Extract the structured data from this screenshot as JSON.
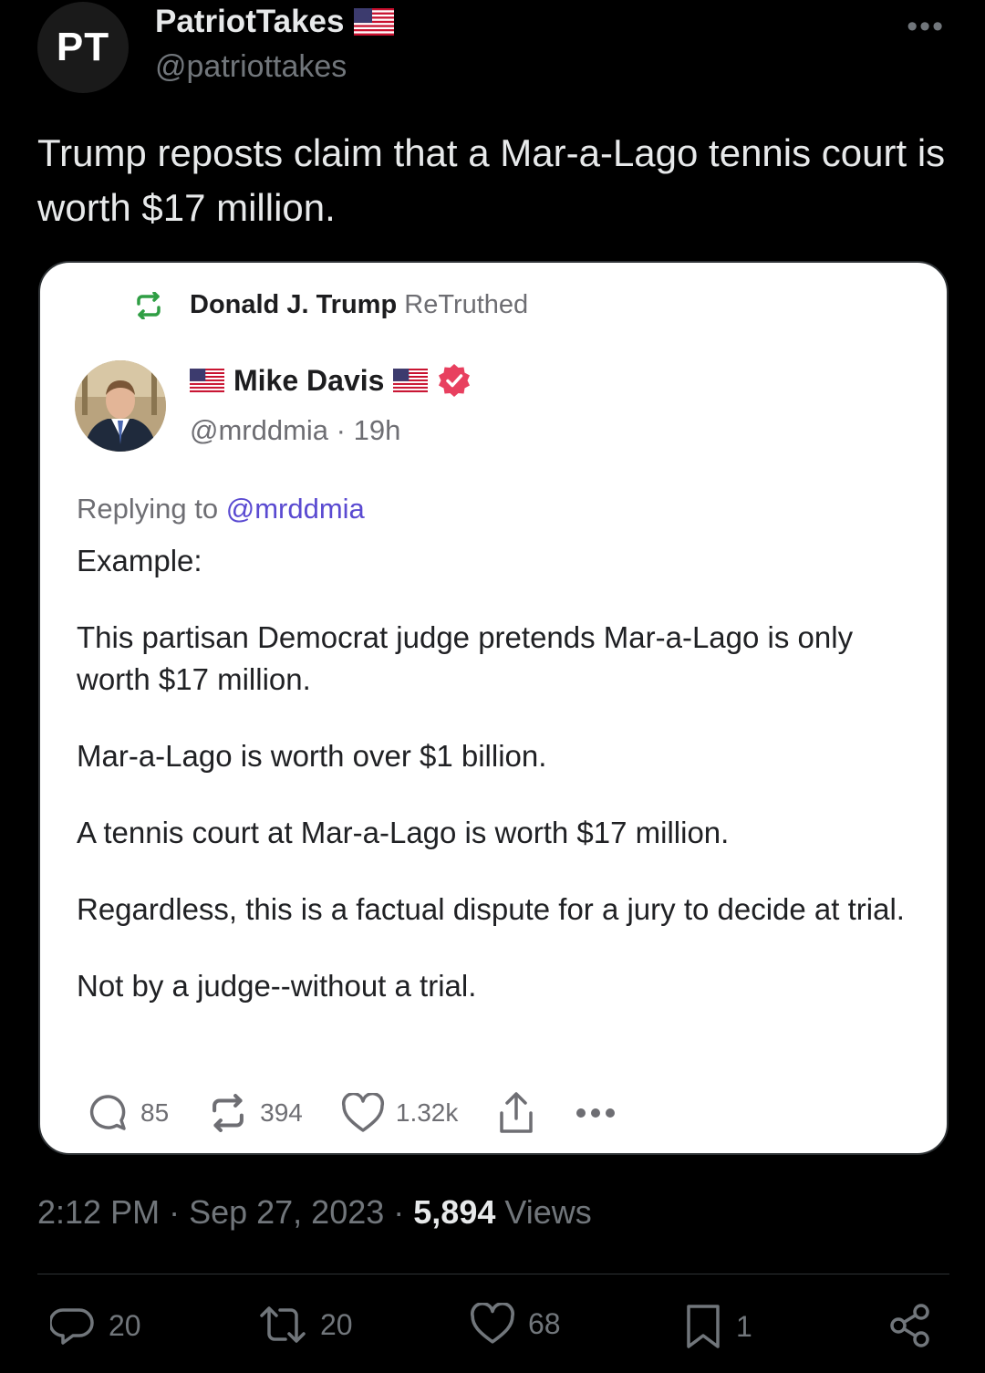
{
  "author": {
    "avatar_initials": "PT",
    "display_name": "PatriotTakes",
    "handle": "@patriottakes",
    "flag_icon": "us-flag-icon"
  },
  "more_label": "•••",
  "post": {
    "text": "Trump reposts claim that a Mar-a-Lago tennis court is worth $17 million."
  },
  "quoted": {
    "retruth_name": "Donald J. Trump",
    "retruth_suffix": "ReTruthed",
    "account_name": "Mike Davis",
    "handle_time": "@mrddmia · 19h",
    "replying_prefix": "Replying to ",
    "replying_mention": "@mrddmia",
    "body": [
      "Example:",
      "This partisan Democrat judge pretends Mar-a-Lago is only worth $17 million.",
      "Mar-a-Lago is worth over $1 billion.",
      "A tennis court at Mar-a-Lago is worth $17 million.",
      "Regardless, this is a factual dispute for a jury to decide at trial.",
      "Not by a judge--without a trial."
    ],
    "stats": {
      "replies": "85",
      "retruths": "394",
      "likes": "1.32k"
    },
    "verified_color": "#e8405f",
    "retruth_icon_color": "#2f9e44"
  },
  "meta": {
    "time": "2:12 PM",
    "date": "Sep 27, 2023",
    "views_count": "5,894",
    "views_label": "Views",
    "sep": " · "
  },
  "actions": {
    "replies": "20",
    "reposts": "20",
    "likes": "68",
    "bookmarks": "1"
  }
}
